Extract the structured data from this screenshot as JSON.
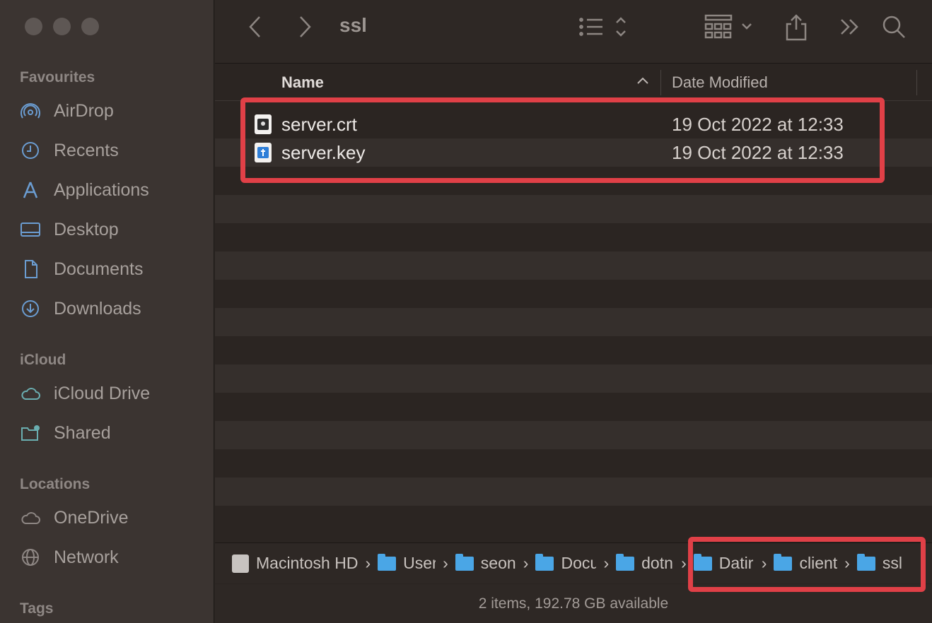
{
  "window": {
    "title": "ssl"
  },
  "sidebar": {
    "sections": [
      {
        "title": "Favourites",
        "items": [
          {
            "label": "AirDrop",
            "icon": "airdrop-icon"
          },
          {
            "label": "Recents",
            "icon": "clock-icon"
          },
          {
            "label": "Applications",
            "icon": "applications-icon"
          },
          {
            "label": "Desktop",
            "icon": "desktop-icon"
          },
          {
            "label": "Documents",
            "icon": "document-icon"
          },
          {
            "label": "Downloads",
            "icon": "download-icon"
          }
        ]
      },
      {
        "title": "iCloud",
        "items": [
          {
            "label": "iCloud Drive",
            "icon": "cloud-icon"
          },
          {
            "label": "Shared",
            "icon": "shared-folder-icon"
          }
        ]
      },
      {
        "title": "Locations",
        "items": [
          {
            "label": "OneDrive",
            "icon": "cloud-icon"
          },
          {
            "label": "Network",
            "icon": "globe-icon"
          }
        ]
      },
      {
        "title": "Tags",
        "items": []
      }
    ]
  },
  "columns": {
    "name": "Name",
    "date": "Date Modified"
  },
  "files": [
    {
      "name": "server.crt",
      "date": "19 Oct 2022 at 12:33",
      "icon": "certificate-file-icon"
    },
    {
      "name": "server.key",
      "date": "19 Oct 2022 at 12:33",
      "icon": "key-file-icon"
    }
  ],
  "path": [
    {
      "label": "Macintosh HD",
      "icon": "hard-drive-icon"
    },
    {
      "label": "User",
      "icon": "folder-icon"
    },
    {
      "label": "seon",
      "icon": "folder-icon"
    },
    {
      "label": "Docu",
      "icon": "folder-icon"
    },
    {
      "label": "dotn",
      "icon": "folder-icon"
    },
    {
      "label": "Datir",
      "icon": "folder-icon"
    },
    {
      "label": "client",
      "icon": "folder-icon"
    },
    {
      "label": "ssl",
      "icon": "folder-icon"
    }
  ],
  "status": "2 items, 192.78 GB available",
  "colors": {
    "highlight": "#e04047",
    "folder": "#4aa6e6"
  }
}
